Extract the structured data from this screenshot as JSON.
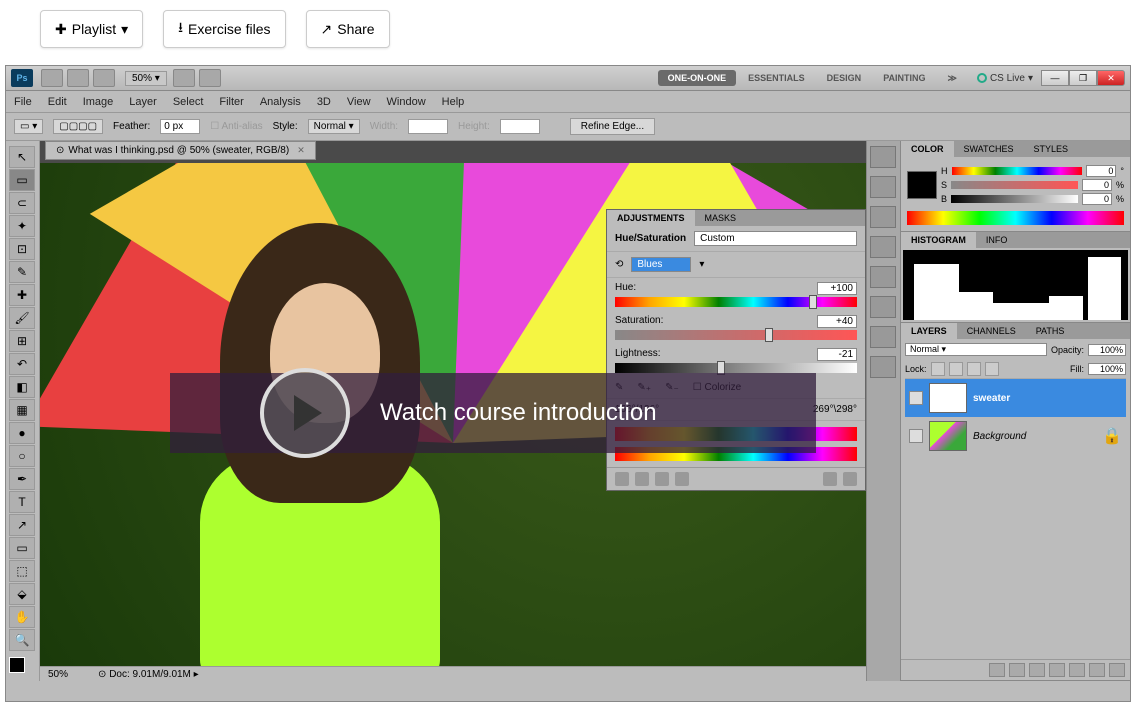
{
  "top": {
    "playlist": "Playlist",
    "exercise": "Exercise files",
    "share": "Share"
  },
  "ps": {
    "logo": "Ps",
    "zoom": "50%",
    "workspaces": [
      "ONE-ON-ONE",
      "ESSENTIALS",
      "DESIGN",
      "PAINTING"
    ],
    "cslive": "CS Live"
  },
  "menu": [
    "File",
    "Edit",
    "Image",
    "Layer",
    "Select",
    "Filter",
    "Analysis",
    "3D",
    "View",
    "Window",
    "Help"
  ],
  "opt": {
    "feather_label": "Feather:",
    "feather": "0 px",
    "aa": "Anti-alias",
    "style_label": "Style:",
    "style": "Normal",
    "width": "Width:",
    "height": "Height:",
    "refine": "Refine Edge..."
  },
  "doc": {
    "tab": "What was I thinking.psd @ 50% (sweater, RGB/8)"
  },
  "adj": {
    "tabs": [
      "ADJUSTMENTS",
      "MASKS"
    ],
    "title": "Hue/Saturation",
    "preset": "Custom",
    "channel": "Blues",
    "hue_label": "Hue:",
    "hue": "+100",
    "sat_label": "Saturation:",
    "sat": "+40",
    "light_label": "Lightness:",
    "light": "-21",
    "colorize": "Colorize",
    "range_left": "166°/196°",
    "range_right": "269°\\298°"
  },
  "overlay": "Watch course introduction",
  "status": {
    "zoom": "50%",
    "doc": "Doc: 9.01M/9.01M"
  },
  "color_panel": {
    "tabs": [
      "COLOR",
      "SWATCHES",
      "STYLES"
    ],
    "h": "0",
    "s": "0",
    "b": "0",
    "unit": "%"
  },
  "histo_panel": {
    "tabs": [
      "HISTOGRAM",
      "INFO"
    ]
  },
  "layers_panel": {
    "tabs": [
      "LAYERS",
      "CHANNELS",
      "PATHS"
    ],
    "mode": "Normal",
    "opacity_label": "Opacity:",
    "opacity": "100%",
    "lock": "Lock:",
    "fill_label": "Fill:",
    "fill": "100%",
    "layer1": "sweater",
    "layer2": "Background"
  }
}
